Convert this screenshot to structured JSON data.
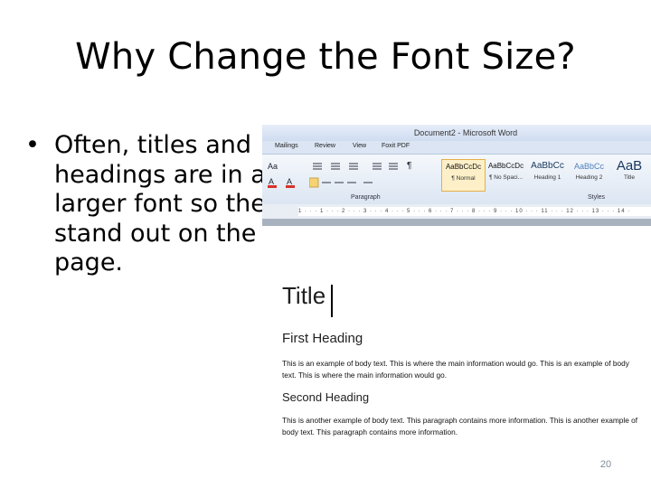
{
  "slide": {
    "title": "Why Change the Font Size?",
    "bullet_symbol": "•",
    "bullet_lines": [
      "Often, titles and",
      "headings are in a",
      "larger font so they",
      "stand out on the",
      "page."
    ],
    "page_number": "20"
  },
  "word": {
    "window_title": "Document2 - Microsoft Word",
    "tabs": [
      "Mailings",
      "Review",
      "View",
      "Foxit PDF"
    ],
    "ribbon": {
      "font_size_btn": "Aa",
      "pilcrow": "¶",
      "paragraph_group": "Paragraph",
      "styles_group": "Styles",
      "styles": [
        {
          "sample": "AaBbCcDc",
          "name": "¶ Normal",
          "active": true
        },
        {
          "sample": "AaBbCcDc",
          "name": "¶ No Spaci..."
        },
        {
          "sample": "AaBbCc",
          "name": "Heading 1"
        },
        {
          "sample": "AaBbCc",
          "name": "Heading 2"
        },
        {
          "sample": "AaB",
          "name": "Title"
        }
      ]
    },
    "ruler_marks": "1 · · · 1 · · · 2 · · · 3 · · · 4 · · · 5 · · · 6 · · · 7 · · · 8 · · · 9 · · · 10 · · · 11 · · · 12 · · · 13 · · · 14 ·"
  },
  "document": {
    "title": "Title",
    "heading1": "First Heading",
    "body1": "This is an example of body text. This is where the main information would go. This is an example of body text. This is where the main information would go.",
    "heading2": "Second Heading",
    "body2": "This is another example of body text. This paragraph contains more information. This is another example of body text. This paragraph contains more information."
  }
}
